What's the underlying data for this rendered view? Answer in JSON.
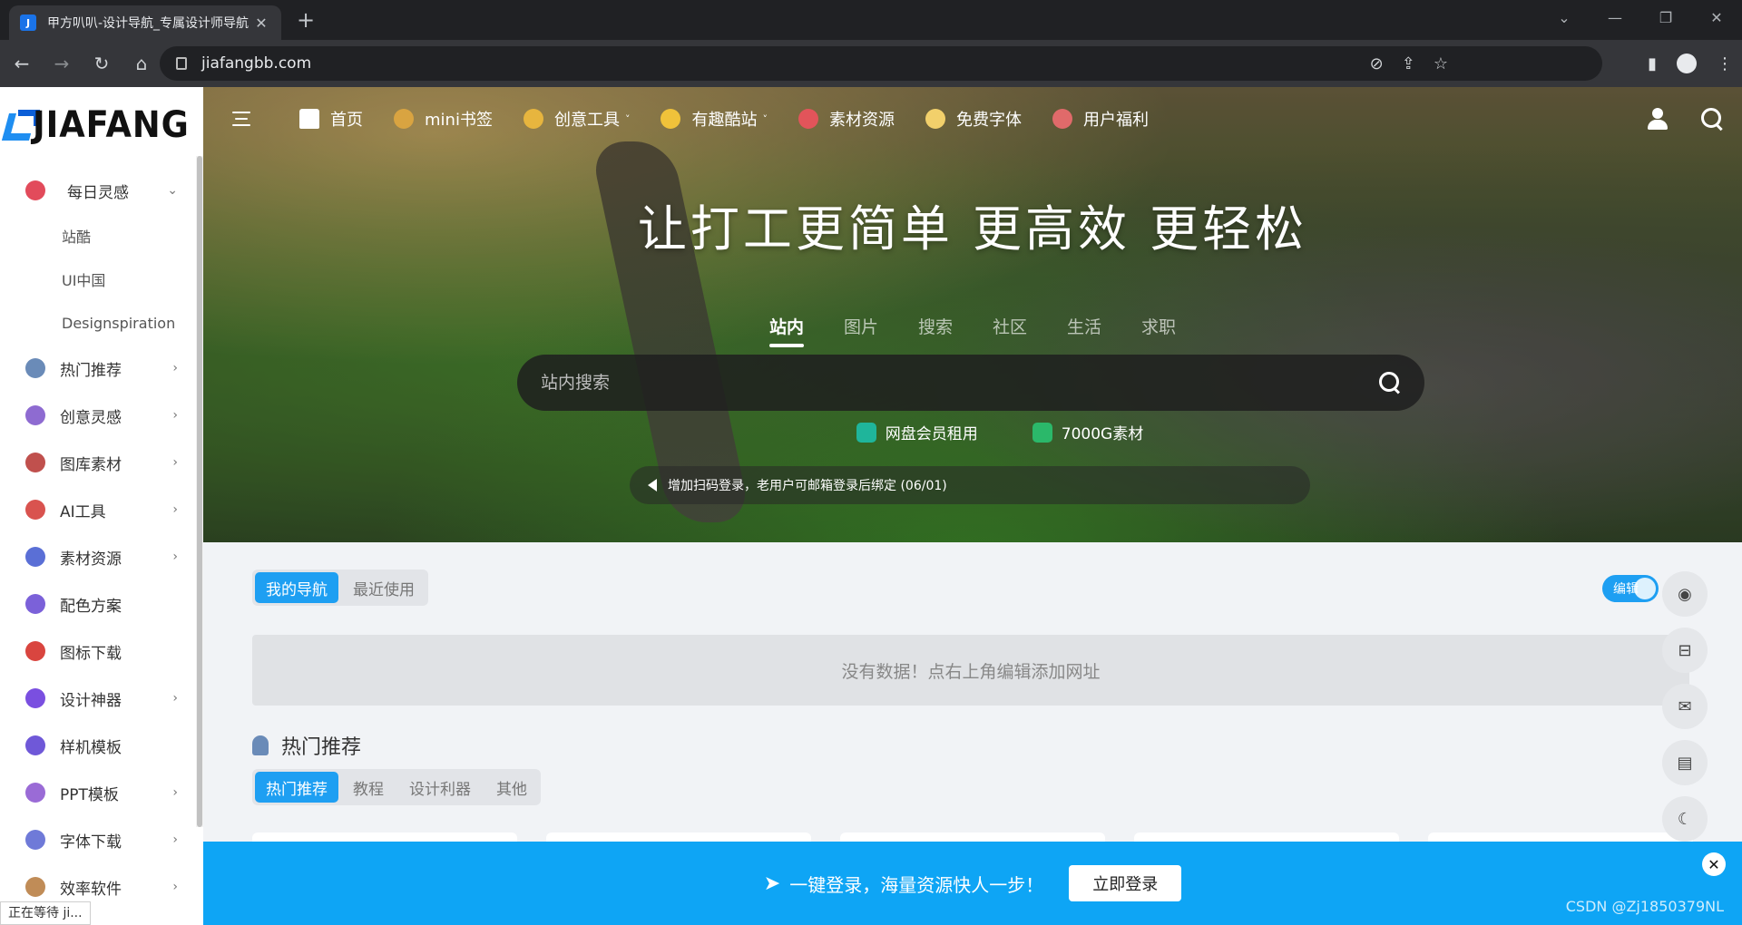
{
  "browser": {
    "tab_title": "甲方叭叭-设计导航_专属设计师导航",
    "url": "jiafangbb.com",
    "status_text": "正在等待 ji..."
  },
  "logo": {
    "text": "JIAFANG"
  },
  "sidebar": {
    "items": [
      {
        "label": "每日灵感",
        "expanded": true,
        "color": "#e24b5b"
      },
      {
        "label": "热门推荐",
        "color": "#6a8bb8"
      },
      {
        "label": "创意灵感",
        "color": "#8e6bd1"
      },
      {
        "label": "图库素材",
        "color": "#c0504d"
      },
      {
        "label": "AI工具",
        "color": "#d9534f"
      },
      {
        "label": "素材资源",
        "color": "#5a6fd6"
      },
      {
        "label": "配色方案",
        "color": "#7b61d9"
      },
      {
        "label": "图标下载",
        "color": "#d9453f"
      },
      {
        "label": "设计神器",
        "color": "#7a4fe0"
      },
      {
        "label": "样机模板",
        "color": "#6f58d8"
      },
      {
        "label": "PPT模板",
        "color": "#9a6bd6"
      },
      {
        "label": "字体下载",
        "color": "#6f7ad8"
      },
      {
        "label": "效率软件",
        "color": "#c08c57"
      }
    ],
    "subitems": [
      "站酷",
      "UI中国",
      "Designspiration"
    ]
  },
  "topnav": {
    "items": [
      {
        "label": "首页",
        "color": "#ffffff"
      },
      {
        "label": "mini书签",
        "color": "#d9a441"
      },
      {
        "label": "创意工具",
        "color": "#e7b53e",
        "caret": "˅"
      },
      {
        "label": "有趣酷站",
        "color": "#f0c23a",
        "caret": "˅"
      },
      {
        "label": "素材资源",
        "color": "#e2545a"
      },
      {
        "label": "免费字体",
        "color": "#f2d06b"
      },
      {
        "label": "用户福利",
        "color": "#e06a6a"
      }
    ]
  },
  "hero": {
    "title": "让打工更简单 更高效 更轻松",
    "search_tabs": [
      "站内",
      "图片",
      "搜索",
      "社区",
      "生活",
      "求职"
    ],
    "search_placeholder": "站内搜索",
    "quicklinks": [
      {
        "label": "网盘会员租用",
        "color": "#1fb59b"
      },
      {
        "label": "7000G素材",
        "color": "#2bb86a"
      }
    ],
    "notice": "增加扫码登录，老用户可邮箱登录后绑定 (06/01)"
  },
  "mynav": {
    "tabs": [
      "我的导航",
      "最近使用"
    ],
    "edit_label": "编辑",
    "empty_text": "没有数据！点右上角编辑添加网址"
  },
  "hot": {
    "title": "热门推荐",
    "tabs": [
      "热门推荐",
      "教程",
      "设计利器",
      "其他"
    ]
  },
  "login_bar": {
    "text": "一键登录，海量资源快人一步！",
    "button": "立即登录"
  },
  "watermark": "CSDN @Zj1850379NL"
}
